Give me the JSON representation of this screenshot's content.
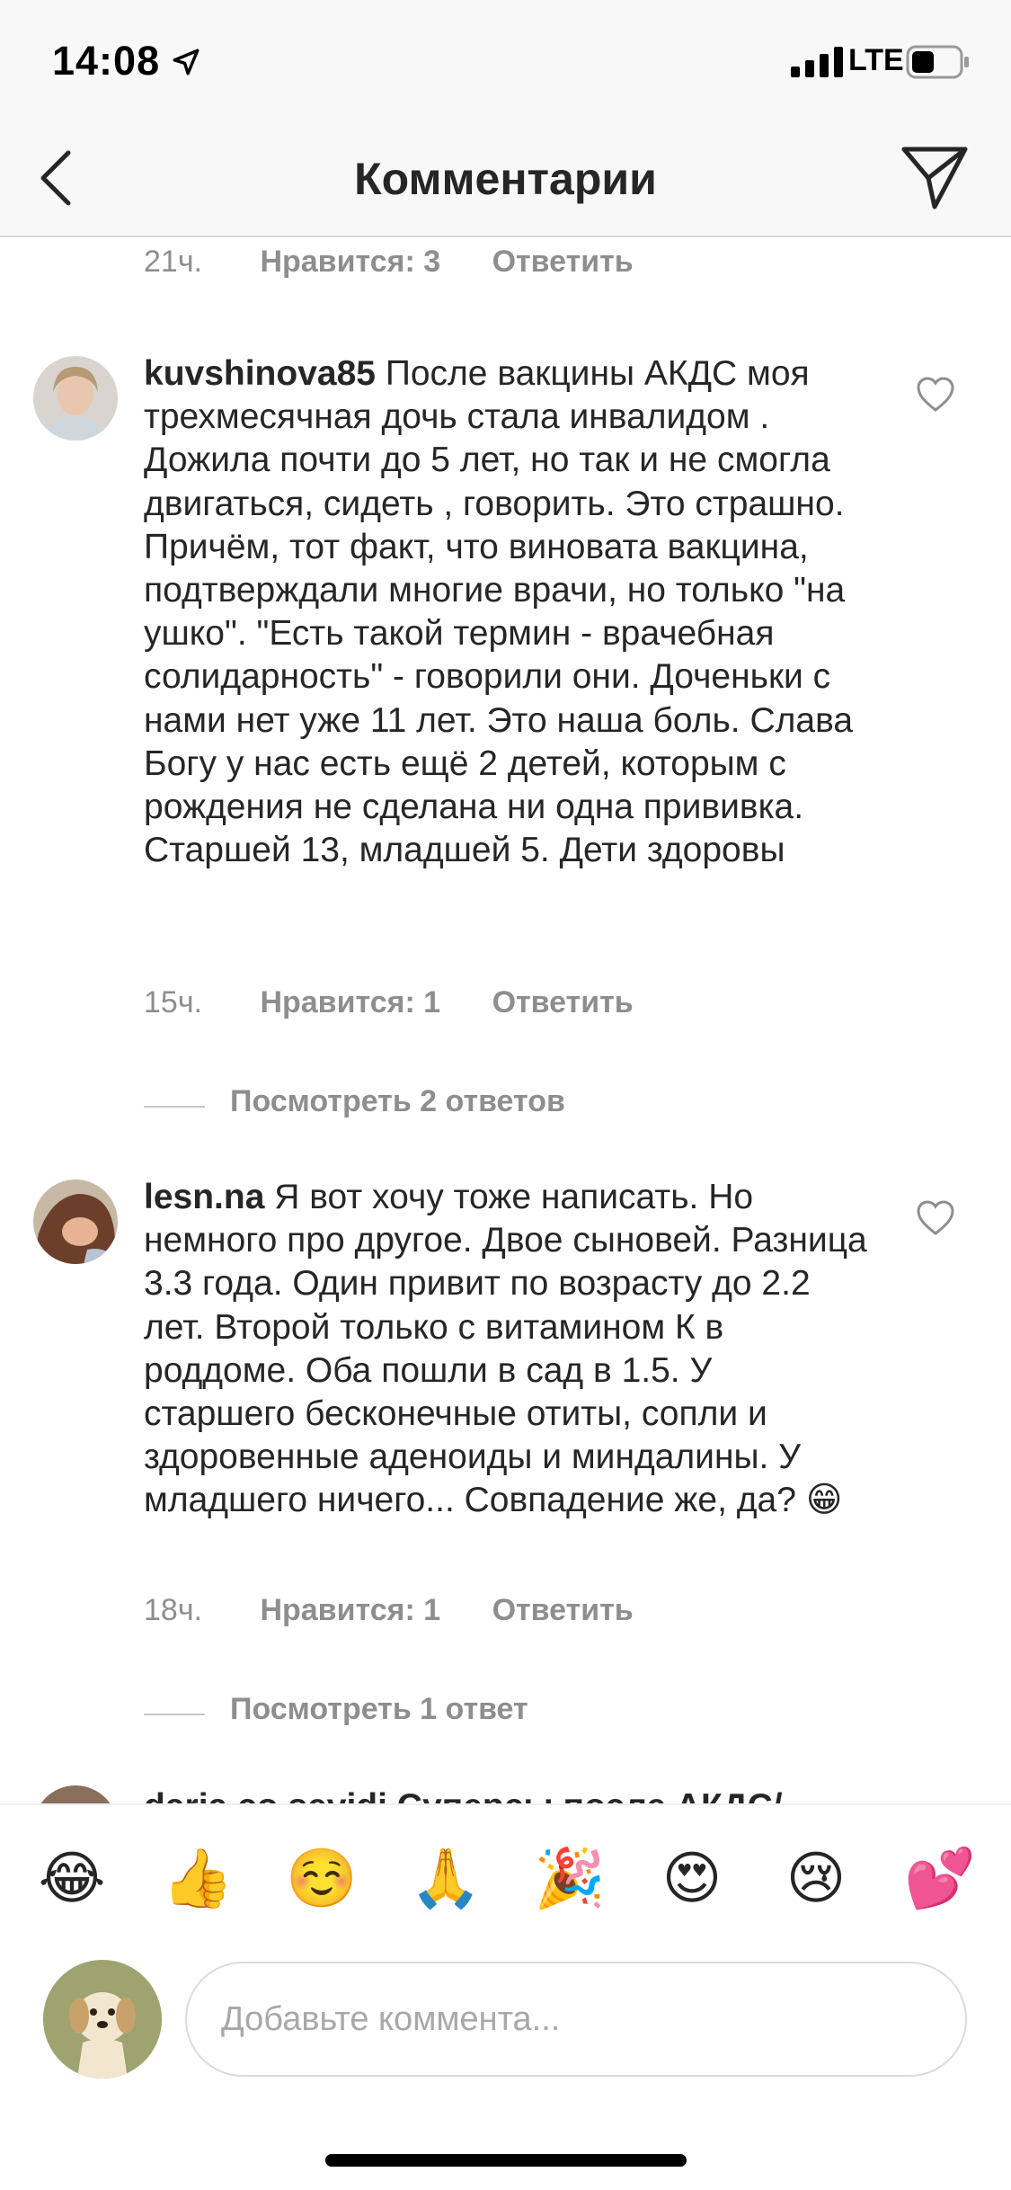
{
  "status_bar": {
    "time": "14:08",
    "network": "LTE",
    "location_icon": "location-arrow-icon",
    "signal_icon": "signal-bars-icon",
    "battery_icon": "battery-icon"
  },
  "nav": {
    "title": "Комментарии",
    "back_icon": "chevron-left-icon",
    "share_icon": "direct-send-icon"
  },
  "top_meta": {
    "time": "21ч.",
    "likes": "Нравится: 3",
    "reply": "Ответить"
  },
  "comments": [
    {
      "username": "kuvshinova85",
      "text": "После вакцины АКДС моя трехмесячная дочь стала инвалидом . Дожила почти до 5 лет, но так и не смогла двигаться, сидеть , говорить. Это страшно. Причём,  тот факт, что виновата вакцина, подтверждали многие врачи, но только \"на ушко\". \"Есть такой термин - врачебная солидарность\" - говорили они. Доченьки с нами нет уже 11 лет. Это наша боль. Слава Богу у нас есть ещё  2 детей, которым с рождения не сделана ни одна прививка. Старшей 13, младшей 5. Дети здоровы",
      "time": "15ч.",
      "likes": "Нравится: 1",
      "reply": "Ответить",
      "view_replies": "Посмотреть 2 ответов"
    },
    {
      "username": "lesn.na",
      "text": "Я вот хочу тоже написать. Но немного про другое. Двое сыновей. Разница 3.3 года. Один привит по возрасту до 2.2 лет. Второй только с витамином К в роддоме. Оба пошли в сад в 1.5. У старшего бесконечные отиты, сопли и здоровенные аденоиды и миндалины. У младшего ничего... Совпадение же, да? 😁",
      "time": "18ч.",
      "likes": "Нравится: 1",
      "reply": "Ответить",
      "view_replies": "Посмотреть 1 ответ"
    }
  ],
  "partial_comment": {
    "text": "daria.co.sevidi Суперсы после АКДС/"
  },
  "emoji_bar": [
    "😂",
    "👍",
    "☺️",
    "🙏",
    "🎉",
    "😍",
    "😢",
    "💕"
  ],
  "input": {
    "placeholder": "Добавьте коммента..."
  },
  "colors": {
    "muted": "#8e8e8e",
    "text": "#262626",
    "divider": "#dbdbdb",
    "header_bg": "#f8f8f8"
  }
}
